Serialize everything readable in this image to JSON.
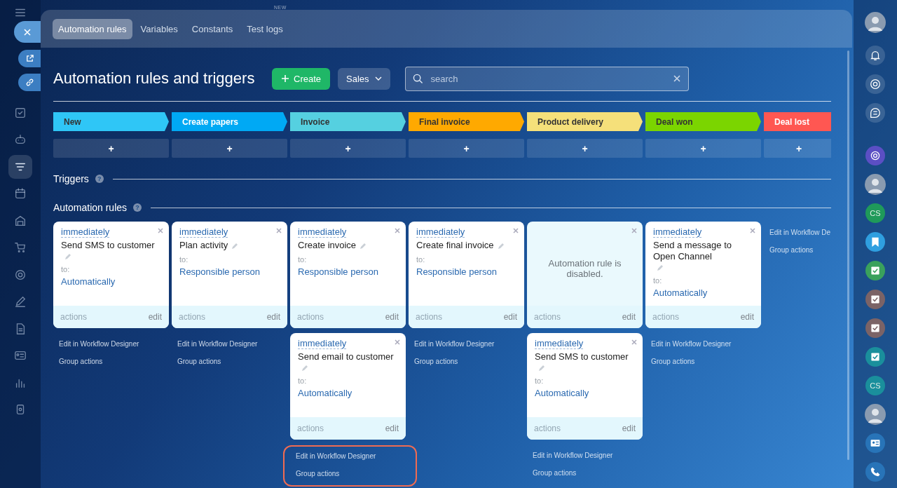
{
  "top_bar": {
    "badge": "NEW"
  },
  "left_sidebar": {
    "items": [
      {
        "selected": false
      },
      {
        "selected": false
      },
      {
        "selected": false
      },
      {
        "selected": true
      },
      {
        "selected": false
      },
      {
        "selected": false
      },
      {
        "selected": false
      },
      {
        "selected": false
      },
      {
        "selected": false
      },
      {
        "selected": false
      },
      {
        "selected": false
      },
      {
        "selected": false
      },
      {
        "selected": false
      }
    ]
  },
  "tabs": [
    {
      "label": "Automation rules",
      "selected": true
    },
    {
      "label": "Variables",
      "selected": false
    },
    {
      "label": "Constants",
      "selected": false
    },
    {
      "label": "Test logs",
      "selected": false
    }
  ],
  "title": "Automation rules and triggers",
  "create_button": "Create",
  "pipeline_button": "Sales",
  "search": {
    "placeholder": "search"
  },
  "stages": [
    {
      "name": "New",
      "color": "#2fc6f6",
      "add": "+"
    },
    {
      "name": "Create papers",
      "color": "#00a9f4",
      "add": "+"
    },
    {
      "name": "Invoice",
      "color": "#55d0e0",
      "add": "+"
    },
    {
      "name": "Final invoice",
      "color": "#ffa900",
      "add": "+"
    },
    {
      "name": "Product delivery",
      "color": "#f5e07a",
      "add": "+"
    },
    {
      "name": "Deal won",
      "color": "#7bd500",
      "add": "+"
    },
    {
      "name": "Deal lost",
      "color": "#ff5752",
      "add": "+"
    }
  ],
  "triggers_heading": "Triggers",
  "triggers_help": "?",
  "rules_heading": "Automation rules",
  "rules_help": "?",
  "rule_columns": [
    {
      "cards": [
        {
          "delay": "immediately",
          "title": "Send SMS to customer",
          "to": "to:",
          "assignee": "Automatically",
          "actions": "actions",
          "edit": "edit",
          "disabled": false
        }
      ],
      "links": [
        "Edit in Workflow Designer",
        "Group actions"
      ],
      "highlighted": false
    },
    {
      "cards": [
        {
          "delay": "immediately",
          "title": "Plan activity",
          "to": "to:",
          "assignee": "Responsible person",
          "actions": "actions",
          "edit": "edit",
          "disabled": false
        }
      ],
      "links": [
        "Edit in Workflow Designer",
        "Group actions"
      ],
      "highlighted": false
    },
    {
      "cards": [
        {
          "delay": "immediately",
          "title": "Create invoice",
          "to": "to:",
          "assignee": "Responsible person",
          "actions": "actions",
          "edit": "edit",
          "disabled": false
        },
        {
          "delay": "immediately",
          "title": "Send email to customer",
          "to": "to:",
          "assignee": "Automatically",
          "actions": "actions",
          "edit": "edit",
          "disabled": false
        }
      ],
      "links": [
        "Edit in Workflow Designer",
        "Group actions"
      ],
      "highlighted": true
    },
    {
      "cards": [
        {
          "delay": "immediately",
          "title": "Create final invoice",
          "to": "to:",
          "assignee": "Responsible person",
          "actions": "actions",
          "edit": "edit",
          "disabled": false
        }
      ],
      "links": [
        "Edit in Workflow Designer",
        "Group actions"
      ],
      "highlighted": false
    },
    {
      "cards": [
        {
          "actions": "actions",
          "edit": "edit",
          "disabled": true,
          "disabled_note": "Automation rule is disabled."
        },
        {
          "delay": "immediately",
          "title": "Send SMS to customer",
          "to": "to:",
          "assignee": "Automatically",
          "actions": "actions",
          "edit": "edit",
          "disabled": false
        }
      ],
      "links": [
        "Edit in Workflow Designer",
        "Group actions"
      ],
      "highlighted": false
    },
    {
      "cards": [
        {
          "delay": "immediately",
          "title": "Send a message to Open Channel",
          "to": "to:",
          "assignee": "Automatically",
          "actions": "actions",
          "edit": "edit",
          "disabled": false
        }
      ],
      "links": [
        "Edit in Workflow Designer",
        "Group actions"
      ],
      "highlighted": false
    },
    {
      "links": [
        "Edit in Workflow De",
        "Group actions"
      ],
      "highlighted": false
    }
  ],
  "right_sidebar": {
    "items": [
      {
        "kind": "avatar"
      },
      {
        "kind": "bell"
      },
      {
        "kind": "target"
      },
      {
        "kind": "chat"
      },
      {
        "kind": "ring",
        "color": "#5b4fc4"
      },
      {
        "kind": "avatar"
      },
      {
        "kind": "initials",
        "text": "CS",
        "color": "#1f9a5a"
      },
      {
        "kind": "bookmark",
        "color": "#2f9fe0"
      },
      {
        "kind": "task",
        "color": "#3aa15c"
      },
      {
        "kind": "task",
        "color": "#7b6366"
      },
      {
        "kind": "task",
        "color": "#7b6366"
      },
      {
        "kind": "task",
        "color": "#1a8f9c"
      },
      {
        "kind": "initials",
        "text": "CS",
        "color": "#1a8f9c"
      },
      {
        "kind": "avatar"
      },
      {
        "kind": "contact",
        "color": "#2874b8"
      },
      {
        "kind": "phone",
        "color": "#2874b8"
      }
    ]
  }
}
